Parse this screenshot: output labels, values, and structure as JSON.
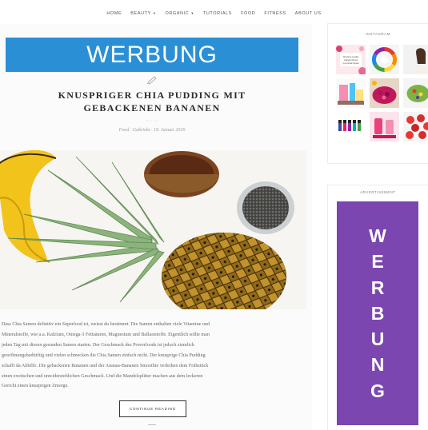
{
  "nav": {
    "items": [
      {
        "label": "HOME",
        "dropdown": false
      },
      {
        "label": "BEAUTY",
        "dropdown": true
      },
      {
        "label": "ORGANIC",
        "dropdown": true
      },
      {
        "label": "TUTORIALS",
        "dropdown": false
      },
      {
        "label": "FOOD",
        "dropdown": false
      },
      {
        "label": "FITNESS",
        "dropdown": false
      },
      {
        "label": "ABOUT US",
        "dropdown": false
      }
    ]
  },
  "main": {
    "banner_text": "WERBUNG",
    "banner_color": "#2b8fd6",
    "title_line1": "KNUSPRIGER CHIA PUDDING MIT",
    "title_line2": "GEBACKENEN BANANEN",
    "rating_glyphs": "•••••",
    "meta": "Food · Gabriela · 19. Januar 2016",
    "excerpt": [
      "Dass Chia Samen definitiv ein Superfood ist, weisst du bestimmt. Die Samen enthalten viele Vitamine und",
      "Mineralstoffe, wie u.a. Kalzium, Omega-3 Fettsäuren, Magnesium und Ballaststoffe. Eigentlich sollte man",
      "jeden Tag mit diesen gesunden Samen starten. Der Geschmack des Powerfoods ist jedoch ziemlich",
      "gewöhnungsbedürftig und vielen schmecken die Chia Samen einfach nicht. Der knusprige Chia Pudding",
      "schafft da Abhilfe. Die gebackenen Bananen und der Ananas-Bananen Smoothie verleihen dem Frühstück",
      "einen exotischen und unwiderstehlichen Geschmack. Und die Mandelsplitter machen aus dem leckeren",
      "Gericht einen knusprigen Zmorge."
    ],
    "continue_label": "CONTINUE READING"
  },
  "sidebar": {
    "instagram_title": "INSTAGRAM",
    "instagram_tiles": [
      {
        "icon": "quote-card-tile",
        "caption": "The more you like yourself, the less you are like anyone else"
      },
      {
        "icon": "color-wheel-tile"
      },
      {
        "icon": "person-tile"
      },
      {
        "icon": "cosmetics-tile"
      },
      {
        "icon": "berry-bowl-tile"
      },
      {
        "icon": "green-bowl-tile"
      },
      {
        "icon": "nail-polish-tile"
      },
      {
        "icon": "drinks-tile"
      },
      {
        "icon": "raspberries-tile"
      }
    ],
    "advertisement_title": "ADVERTISEMENT",
    "ad_letters": [
      "W",
      "E",
      "R",
      "B",
      "U",
      "N",
      "G"
    ],
    "ad_color": "#7b46b0"
  }
}
